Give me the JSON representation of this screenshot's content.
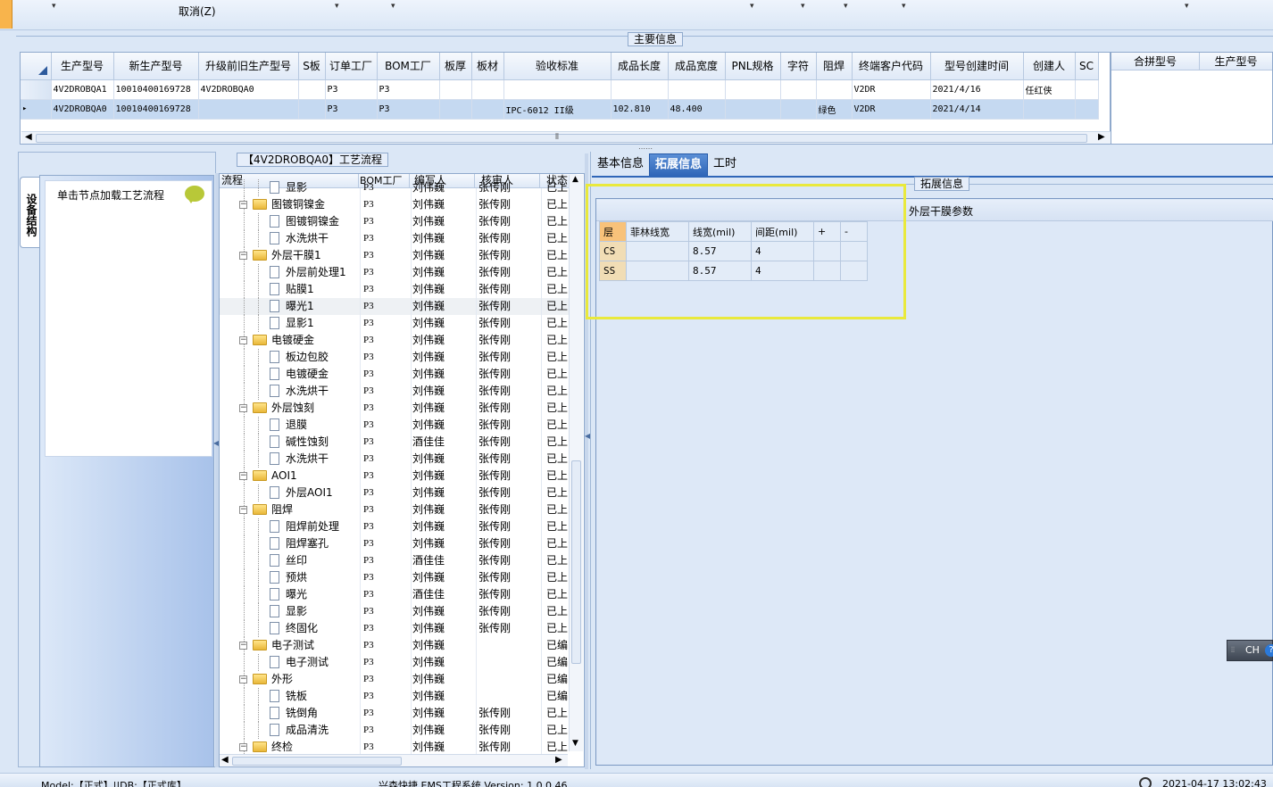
{
  "toolbar": {
    "cancel_label": "取消(Z)"
  },
  "main_info": {
    "title": "主要信息",
    "columns": [
      "生产型号",
      "新生产型号",
      "升级前旧生产型号",
      "S板",
      "订单工厂",
      "BOM工厂",
      "板厚",
      "板材",
      "验收标准",
      "成品长度",
      "成品宽度",
      "PNL规格",
      "字符",
      "阻焊",
      "终端客户代码",
      "型号创建时间",
      "创建人",
      "SC"
    ],
    "rows": [
      [
        "4V2DROBQA1",
        "10010400169728",
        "4V2DROBQA0",
        "",
        "P3",
        "P3",
        "",
        "",
        "",
        "",
        "",
        "",
        "",
        "",
        "V2DR",
        "2021/4/16",
        "任红侠",
        ""
      ],
      [
        "4V2DROBQA0",
        "10010400169728",
        "",
        "",
        "P3",
        "P3",
        "",
        "",
        "IPC-6012 II级",
        "102.810",
        "48.400",
        "",
        "",
        "绿色",
        "V2DR",
        "2021/4/14",
        "",
        ""
      ]
    ],
    "row_indicator": "▸"
  },
  "combine": {
    "columns": [
      "合拼型号",
      "生产型号"
    ]
  },
  "left_panel": {
    "tab_label": "设备结构",
    "load_label": "单击节点加载工艺流程"
  },
  "process": {
    "title": "【4V2DROBQA0】工艺流程",
    "columns": [
      "流程",
      "BOM工厂",
      "编写人",
      "核审人",
      "状态"
    ],
    "rows": [
      {
        "name": "显影",
        "level": 2,
        "factory": "P3",
        "author": "刘伟巍",
        "reviewer": "张传刚",
        "status": "已上"
      },
      {
        "name": "图镀铜镍金",
        "level": 1,
        "factory": "P3",
        "author": "刘伟巍",
        "reviewer": "张传刚",
        "status": "已上"
      },
      {
        "name": "图镀铜镍金",
        "level": 2,
        "factory": "P3",
        "author": "刘伟巍",
        "reviewer": "张传刚",
        "status": "已上"
      },
      {
        "name": "水洗烘干",
        "level": 2,
        "factory": "P3",
        "author": "刘伟巍",
        "reviewer": "张传刚",
        "status": "已上"
      },
      {
        "name": "外层干膜1",
        "level": 1,
        "factory": "P3",
        "author": "刘伟巍",
        "reviewer": "张传刚",
        "status": "已上"
      },
      {
        "name": "外层前处理1",
        "level": 2,
        "factory": "P3",
        "author": "刘伟巍",
        "reviewer": "张传刚",
        "status": "已上"
      },
      {
        "name": "贴膜1",
        "level": 2,
        "factory": "P3",
        "author": "刘伟巍",
        "reviewer": "张传刚",
        "status": "已上"
      },
      {
        "name": "曝光1",
        "level": 2,
        "factory": "P3",
        "author": "刘伟巍",
        "reviewer": "张传刚",
        "status": "已上"
      },
      {
        "name": "显影1",
        "level": 2,
        "factory": "P3",
        "author": "刘伟巍",
        "reviewer": "张传刚",
        "status": "已上"
      },
      {
        "name": "电镀硬金",
        "level": 1,
        "factory": "P3",
        "author": "刘伟巍",
        "reviewer": "张传刚",
        "status": "已上"
      },
      {
        "name": "板边包胶",
        "level": 2,
        "factory": "P3",
        "author": "刘伟巍",
        "reviewer": "张传刚",
        "status": "已上"
      },
      {
        "name": "电镀硬金",
        "level": 2,
        "factory": "P3",
        "author": "刘伟巍",
        "reviewer": "张传刚",
        "status": "已上"
      },
      {
        "name": "水洗烘干",
        "level": 2,
        "factory": "P3",
        "author": "刘伟巍",
        "reviewer": "张传刚",
        "status": "已上"
      },
      {
        "name": "外层蚀刻",
        "level": 1,
        "factory": "P3",
        "author": "刘伟巍",
        "reviewer": "张传刚",
        "status": "已上"
      },
      {
        "name": "退膜",
        "level": 2,
        "factory": "P3",
        "author": "刘伟巍",
        "reviewer": "张传刚",
        "status": "已上"
      },
      {
        "name": "碱性蚀刻",
        "level": 2,
        "factory": "P3",
        "author": "酒佳佳",
        "reviewer": "张传刚",
        "status": "已上"
      },
      {
        "name": "水洗烘干",
        "level": 2,
        "factory": "P3",
        "author": "刘伟巍",
        "reviewer": "张传刚",
        "status": "已上"
      },
      {
        "name": "AOI1",
        "level": 1,
        "factory": "P3",
        "author": "刘伟巍",
        "reviewer": "张传刚",
        "status": "已上"
      },
      {
        "name": "外层AOI1",
        "level": 2,
        "factory": "P3",
        "author": "刘伟巍",
        "reviewer": "张传刚",
        "status": "已上"
      },
      {
        "name": "阻焊",
        "level": 1,
        "factory": "P3",
        "author": "刘伟巍",
        "reviewer": "张传刚",
        "status": "已上"
      },
      {
        "name": "阻焊前处理",
        "level": 2,
        "factory": "P3",
        "author": "刘伟巍",
        "reviewer": "张传刚",
        "status": "已上"
      },
      {
        "name": "阻焊塞孔",
        "level": 2,
        "factory": "P3",
        "author": "刘伟巍",
        "reviewer": "张传刚",
        "status": "已上"
      },
      {
        "name": "丝印",
        "level": 2,
        "factory": "P3",
        "author": "酒佳佳",
        "reviewer": "张传刚",
        "status": "已上"
      },
      {
        "name": "预烘",
        "level": 2,
        "factory": "P3",
        "author": "刘伟巍",
        "reviewer": "张传刚",
        "status": "已上"
      },
      {
        "name": "曝光",
        "level": 2,
        "factory": "P3",
        "author": "酒佳佳",
        "reviewer": "张传刚",
        "status": "已上"
      },
      {
        "name": "显影",
        "level": 2,
        "factory": "P3",
        "author": "刘伟巍",
        "reviewer": "张传刚",
        "status": "已上"
      },
      {
        "name": "终固化",
        "level": 2,
        "factory": "P3",
        "author": "刘伟巍",
        "reviewer": "张传刚",
        "status": "已上"
      },
      {
        "name": "电子测试",
        "level": 1,
        "factory": "P3",
        "author": "刘伟巍",
        "reviewer": "",
        "status": "已编"
      },
      {
        "name": "电子测试",
        "level": 2,
        "factory": "P3",
        "author": "刘伟巍",
        "reviewer": "",
        "status": "已编"
      },
      {
        "name": "外形",
        "level": 1,
        "factory": "P3",
        "author": "刘伟巍",
        "reviewer": "",
        "status": "已编"
      },
      {
        "name": "铣板",
        "level": 2,
        "factory": "P3",
        "author": "刘伟巍",
        "reviewer": "",
        "status": "已编"
      },
      {
        "name": "铣倒角",
        "level": 2,
        "factory": "P3",
        "author": "刘伟巍",
        "reviewer": "张传刚",
        "status": "已上"
      },
      {
        "name": "成品清洗",
        "level": 2,
        "factory": "P3",
        "author": "刘伟巍",
        "reviewer": "张传刚",
        "status": "已上"
      },
      {
        "name": "终检",
        "level": 1,
        "factory": "P3",
        "author": "刘伟巍",
        "reviewer": "张传刚",
        "status": "已上"
      }
    ],
    "highlighted_row": 7
  },
  "right_tabs": [
    "基本信息",
    "拓展信息",
    "工时"
  ],
  "active_tab": 1,
  "extension": {
    "group_title": "拓展信息",
    "section_label": "外层干膜参数",
    "columns": [
      "层",
      "菲林线宽",
      "线宽(mil)",
      "间距(mil)",
      "+",
      "-"
    ],
    "rows": [
      [
        "CS",
        "",
        "8.57",
        "4",
        "",
        ""
      ],
      [
        "SS",
        "",
        "8.57",
        "4",
        "",
        ""
      ]
    ]
  },
  "ime": {
    "label": "CH",
    "help": "?"
  },
  "status_bar": {
    "model": "Model:【正式】||DB:【正式库】",
    "app": "兴森快捷 EMS工程系统 Version: 1.0.0.46",
    "time": "2021-04-17 13:02:43"
  },
  "colors": {
    "highlight_box": "#e9e93c",
    "active_tab": "#2f66b8",
    "selected_row": "#c5d9f1",
    "layer_header": "#f8c27a"
  }
}
